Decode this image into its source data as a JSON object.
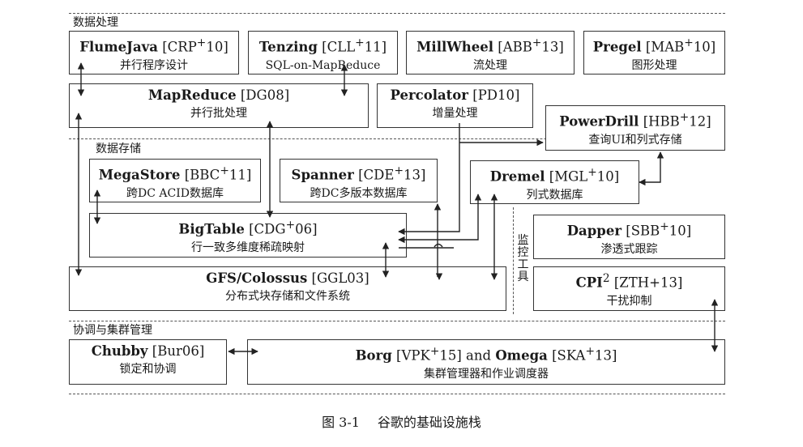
{
  "sections": {
    "data_processing": "数据处理",
    "data_storage": "数据存储",
    "monitoring": "监控工具",
    "coordination": "协调与集群管理"
  },
  "boxes": {
    "flumejava": {
      "name": "FlumeJava",
      "ref": "[CRP",
      "sup": "+",
      "ref2": "10]",
      "desc": "并行程序设计"
    },
    "tenzing": {
      "name": "Tenzing",
      "ref": "[CLL",
      "sup": "+",
      "ref2": "11]",
      "desc": "SQL-on-MapReduce"
    },
    "millwheel": {
      "name": "MillWheel",
      "ref": "[ABB",
      "sup": "+",
      "ref2": "13]",
      "desc": "流处理"
    },
    "pregel": {
      "name": "Pregel",
      "ref": "[MAB",
      "sup": "+",
      "ref2": "10]",
      "desc": "图形处理"
    },
    "mapreduce": {
      "name": "MapReduce",
      "ref": "[DG08]",
      "sup": "",
      "ref2": "",
      "desc": "并行批处理"
    },
    "percolator": {
      "name": "Percolator",
      "ref": "[PD10]",
      "sup": "",
      "ref2": "",
      "desc": "增量处理"
    },
    "powerdrill": {
      "name": "PowerDrill",
      "ref": "[HBB",
      "sup": "+",
      "ref2": "12]",
      "desc": "查询UI和列式存储"
    },
    "megastore": {
      "name": "MegaStore",
      "ref": "[BBC",
      "sup": "+",
      "ref2": "11]",
      "desc": "跨DC ACID数据库"
    },
    "spanner": {
      "name": "Spanner",
      "ref": "[CDE",
      "sup": "+",
      "ref2": "13]",
      "desc": "跨DC多版本数据库"
    },
    "dremel": {
      "name": "Dremel",
      "ref": "[MGL",
      "sup": "+",
      "ref2": "10]",
      "desc": "列式数据库"
    },
    "bigtable": {
      "name": "BigTable",
      "ref": "[CDG",
      "sup": "+",
      "ref2": "06]",
      "desc": "行一致多维度稀疏映射"
    },
    "gfs": {
      "name": "GFS/Colossus",
      "ref": "[GGL03]",
      "sup": "",
      "ref2": "",
      "desc": "分布式块存储和文件系统"
    },
    "dapper": {
      "name": "Dapper",
      "ref": "[SBB",
      "sup": "+",
      "ref2": "10]",
      "desc": "渗透式跟踪"
    },
    "cpi": {
      "name": "CPI",
      "ref": "[ZTH",
      "sup": "2",
      "ref2": "+13]",
      "desc": "干扰抑制"
    },
    "chubby": {
      "name": "Chubby",
      "ref": "[Bur06]",
      "sup": "",
      "ref2": "",
      "desc": "锁定和协调"
    },
    "borg": {
      "name": "Borg",
      "ref": "[VPK",
      "sup": "+",
      "ref2": "15] and",
      "name2": "Omega",
      "ref3": "[SKA",
      "sup2": "+",
      "ref4": "13]",
      "desc": "集群管理器和作业调度器"
    }
  },
  "caption": {
    "fig": "图 3-1",
    "title": "谷歌的基础设施栈"
  }
}
